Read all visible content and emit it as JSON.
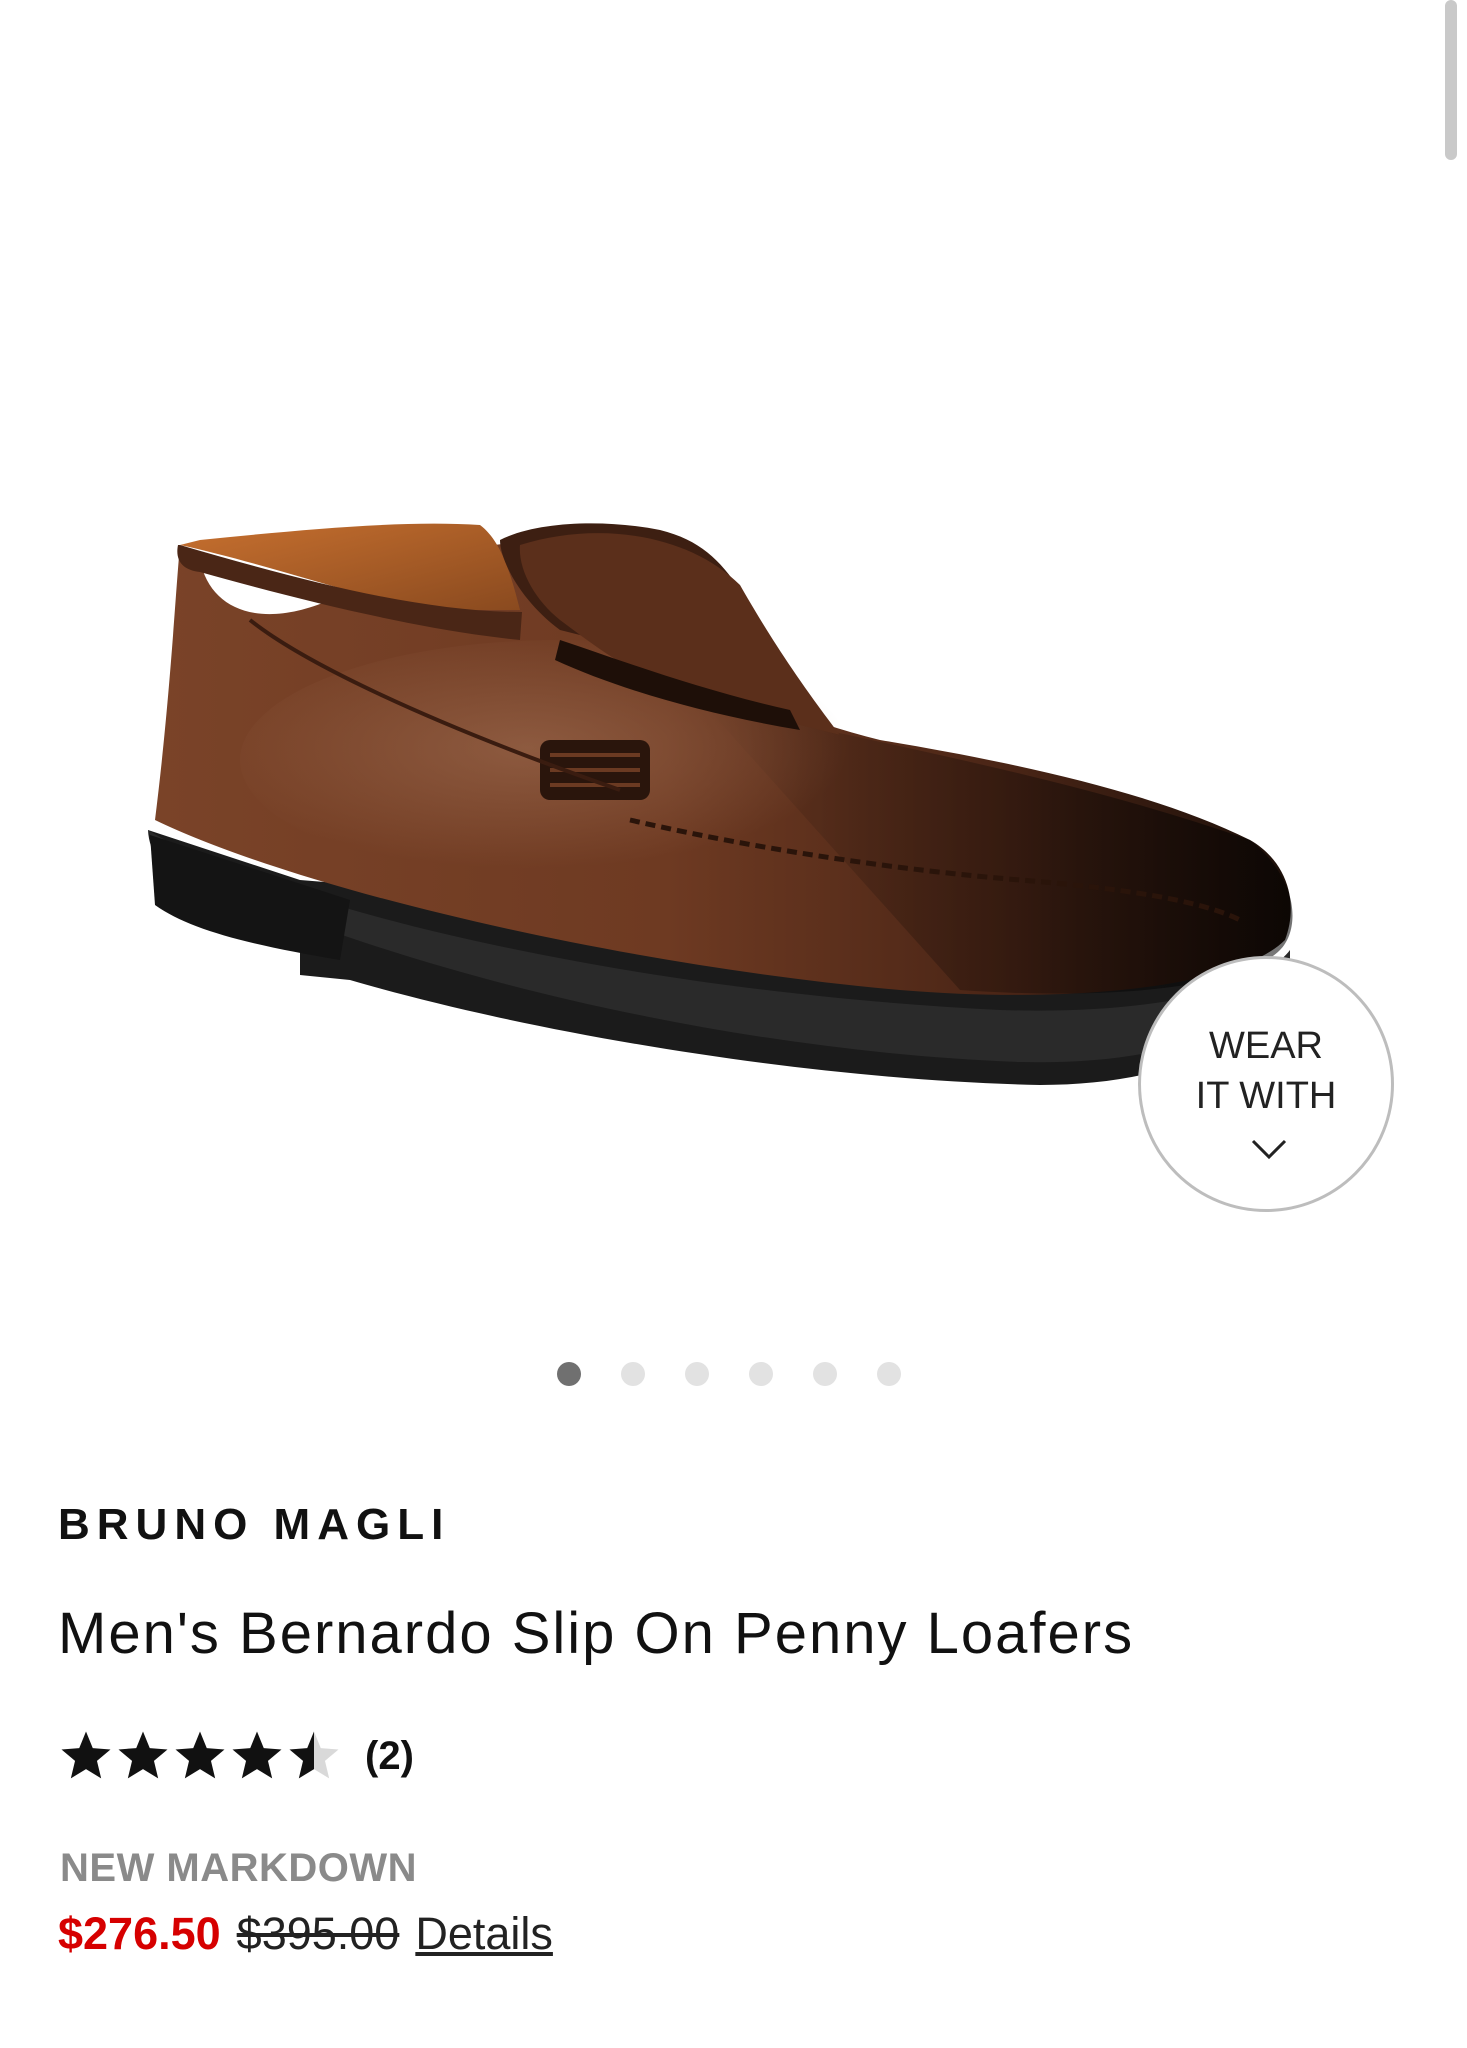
{
  "product": {
    "brand": "BRUNO MAGLI",
    "title": "Men's Bernardo Slip On Penny Loafers",
    "rating": {
      "stars": 4.5,
      "max_stars": 5,
      "review_count": "(2)"
    },
    "markdown_label": "NEW MARKDOWN",
    "sale_price": "$276.50",
    "original_price": "$395.00",
    "details_link": "Details"
  },
  "gallery": {
    "image_count": 6,
    "active_index": 0,
    "wear_it_with": {
      "line1": "WEAR",
      "line2": "IT WITH",
      "icon": "chevron-down-icon"
    }
  },
  "colors": {
    "sale_red": "#d60000",
    "markdown_gray": "#8a8a8a",
    "dot_active": "#707070",
    "dot_inactive": "#e2e2e2",
    "shoe_brown": "#6b3a22"
  }
}
